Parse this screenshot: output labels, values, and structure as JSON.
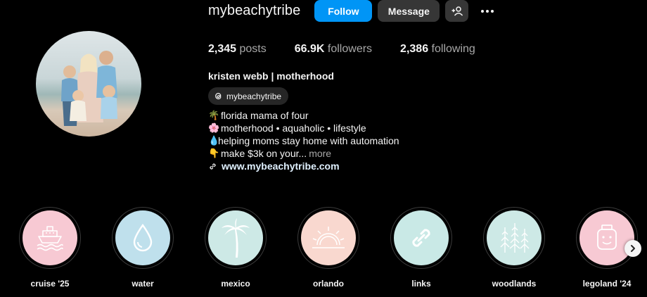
{
  "profile": {
    "username": "mybeachytribe",
    "full_name": "kristen webb | motherhood",
    "threads_handle": "mybeachytribe",
    "website": "www.mybeachytribe.com"
  },
  "actions": {
    "follow_label": "Follow",
    "message_label": "Message",
    "add_user_icon": "person-plus-icon",
    "more_icon": "ellipsis-icon"
  },
  "stats": {
    "posts_count": "2,345",
    "posts_label": "posts",
    "followers_count": "66.9K",
    "followers_label": "followers",
    "following_count": "2,386",
    "following_label": "following"
  },
  "bio": {
    "lines": [
      {
        "emoji": "🌴",
        "text": "florida mama of four"
      },
      {
        "emoji": "🌸",
        "text": "motherhood • aquaholic • lifestyle"
      },
      {
        "emoji": "💧",
        "text": "helping moms stay home with automation"
      },
      {
        "emoji": "👇",
        "text": "make $3k on your..."
      }
    ],
    "more_label": "more"
  },
  "highlights": [
    {
      "label": "cruise '25",
      "icon": "ship-icon",
      "color": "#f7c9d3"
    },
    {
      "label": "water",
      "icon": "droplet-icon",
      "color": "#bfe0ec"
    },
    {
      "label": "mexico",
      "icon": "palm-tree-icon",
      "color": "#cde9e6"
    },
    {
      "label": "orlando",
      "icon": "sun-icon",
      "color": "#f9d8cf"
    },
    {
      "label": "links",
      "icon": "link-icon",
      "color": "#c9e9e6"
    },
    {
      "label": "woodlands",
      "icon": "pine-trees-icon",
      "color": "#cde9e6"
    },
    {
      "label": "legoland '24",
      "icon": "lego-head-icon",
      "color": "#f7c9d3"
    }
  ],
  "colors": {
    "background": "#000000",
    "accent": "#0095f6",
    "button_secondary": "#363636",
    "muted_text": "#a8a8a8"
  }
}
